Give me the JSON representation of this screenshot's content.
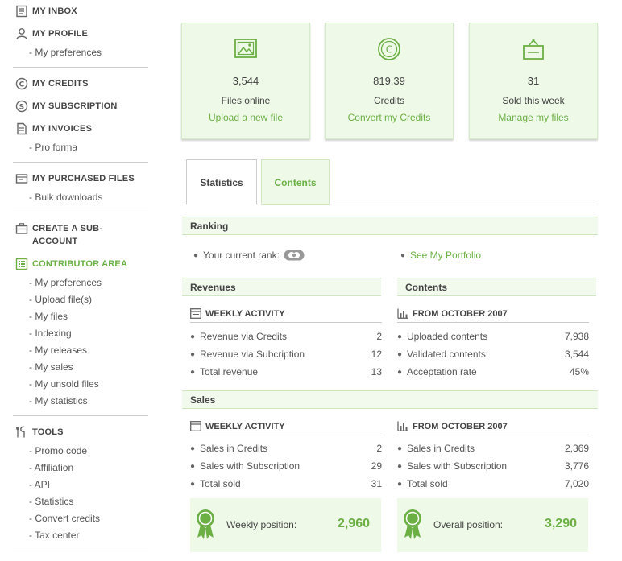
{
  "sidebar": {
    "inbox": "MY INBOX",
    "profile": "MY PROFILE",
    "profile_sub": [
      "- My preferences"
    ],
    "credits": "MY CREDITS",
    "subscription": "MY SUBSCRIPTION",
    "invoices": "MY INVOICES",
    "invoices_sub": [
      "- Pro forma"
    ],
    "purchased": "MY PURCHASED FILES",
    "purchased_sub": [
      "- Bulk downloads"
    ],
    "create_sub_l1": "CREATE A SUB-",
    "create_sub_l2": "ACCOUNT",
    "contributor": "CONTRIBUTOR AREA",
    "contributor_sub": [
      "- My preferences",
      "- Upload file(s)",
      "- My files",
      "- Indexing",
      "- My releases",
      "- My sales",
      "- My unsold files",
      "- My statistics"
    ],
    "tools": "TOOLS",
    "tools_sub": [
      "- Promo code",
      "- Affiliation",
      "- API",
      "- Statistics",
      "- Convert credits",
      "- Tax center"
    ]
  },
  "cards": [
    {
      "icon": "image-icon",
      "value": "3,544",
      "label": "Files online",
      "link": "Upload a new file"
    },
    {
      "icon": "credit-coin-icon",
      "value": "819.39",
      "label": "Credits",
      "link": "Convert my Credits"
    },
    {
      "icon": "sold-sign-icon",
      "value": "31",
      "label": "Sold this week",
      "link": "Manage my files"
    }
  ],
  "tabs": {
    "statistics": "Statistics",
    "contents": "Contents"
  },
  "ranking": {
    "title": "Ranking",
    "current_rank_label": "Your current rank:",
    "portfolio_link": "See My Portfolio"
  },
  "revenues": {
    "title": "Revenues",
    "subhead": "WEEKLY ACTIVITY",
    "rows": [
      {
        "label": "Revenue via Credits",
        "value": "2"
      },
      {
        "label": "Revenue via Subcription",
        "value": "12"
      },
      {
        "label": "Total revenue",
        "value": "13"
      }
    ]
  },
  "contents": {
    "title": "Contents",
    "subhead": "FROM OCTOBER 2007",
    "rows": [
      {
        "label": "Uploaded contents",
        "value": "7,938"
      },
      {
        "label": "Validated contents",
        "value": "3,544"
      },
      {
        "label": "Acceptation rate",
        "value": "45%"
      }
    ]
  },
  "sales": {
    "title": "Sales",
    "weekly": {
      "subhead": "WEEKLY ACTIVITY",
      "rows": [
        {
          "label": "Sales in Credits",
          "value": "2"
        },
        {
          "label": "Sales with Subscription",
          "value": "29"
        },
        {
          "label": "Total sold",
          "value": "31"
        }
      ],
      "position_label": "Weekly position:",
      "position_value": "2,960"
    },
    "overall": {
      "subhead": "FROM OCTOBER 2007",
      "rows": [
        {
          "label": "Sales in Credits",
          "value": "2,369"
        },
        {
          "label": "Sales with Subscription",
          "value": "3,776"
        },
        {
          "label": "Total sold",
          "value": "7,020"
        }
      ],
      "position_label": "Overall position:",
      "position_value": "3,290"
    }
  },
  "colors": {
    "accent": "#6cb045",
    "panel_bg": "#eef9e8",
    "bar_bg": "#f2faee",
    "border": "#cfe6c1"
  }
}
